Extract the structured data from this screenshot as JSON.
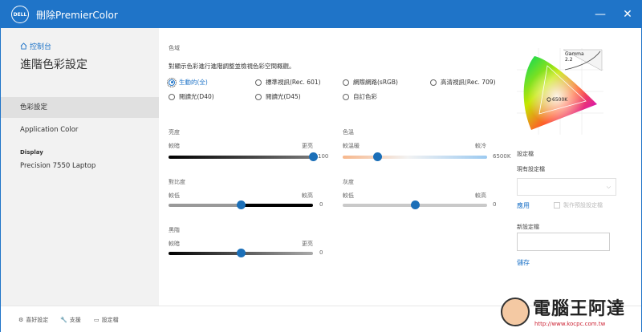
{
  "titlebar": {
    "logo": "DELL",
    "title": "刪除PremierColor",
    "minimize_icon": "—",
    "close_icon": "✕"
  },
  "sidebar": {
    "home_label": "控制台",
    "page_title": "進階色彩設定",
    "items": [
      {
        "label": "色彩設定"
      },
      {
        "label": "Application Color"
      }
    ],
    "display_heading": "Display",
    "display_device": "Precision 7550 Laptop"
  },
  "main": {
    "gamut_label": "色域",
    "description": "對顯示色彩進行進階調整並檢視色彩空間概觀。",
    "gamut_options": [
      {
        "label": "生動的(全)",
        "selected": true
      },
      {
        "label": "標準視訊(Rec. 601)",
        "selected": false
      },
      {
        "label": "網際網路(sRGB)",
        "selected": false
      },
      {
        "label": "高清視訊(Rec. 709)",
        "selected": false
      },
      {
        "label": "閱讀光(D40)",
        "selected": false
      },
      {
        "label": "閱讀光(D45)",
        "selected": false
      },
      {
        "label": "自訂色彩",
        "selected": false
      }
    ],
    "brightness": {
      "label": "亮度",
      "min_label": "較暗",
      "max_label": "更亮",
      "value": "100",
      "fraction": 1.0
    },
    "color_temp": {
      "label": "色溫",
      "min_label": "較溫暖",
      "max_label": "較冷",
      "value": "6500K",
      "fraction": 0.24
    },
    "contrast": {
      "label": "對比度",
      "min_label": "較低",
      "max_label": "較高",
      "value": "0",
      "fraction": 0.5
    },
    "hue": {
      "label": "灰度",
      "min_label": "較低",
      "max_label": "較高",
      "value": "0",
      "fraction": 0.5
    },
    "gamma": {
      "label": "黑階",
      "min_label": "較暗",
      "max_label": "更亮",
      "value": "0",
      "fraction": 0.5
    },
    "chromaticity": {
      "gamma_label": "Gamma",
      "gamma_value": "2.2",
      "white_point": "6500K"
    }
  },
  "presets": {
    "section_label": "設定檔",
    "existing_label": "現有設定檔",
    "select_value": "",
    "apply_label": "應用",
    "restore_label": "製作預設設定檔",
    "new_label": "新設定檔",
    "new_value": "",
    "save_label": "儲存"
  },
  "bottombar": {
    "preferences_label": "喜好設定",
    "support_label": "支援",
    "settings_label": "設定檔"
  },
  "watermark": {
    "title": "電腦王阿達",
    "url": "http://www.kocpc.com.tw"
  },
  "colors": {
    "accent": "#1f74c8",
    "sidebar_bg": "#f2f2f2",
    "thumb": "#1b6fb8"
  }
}
